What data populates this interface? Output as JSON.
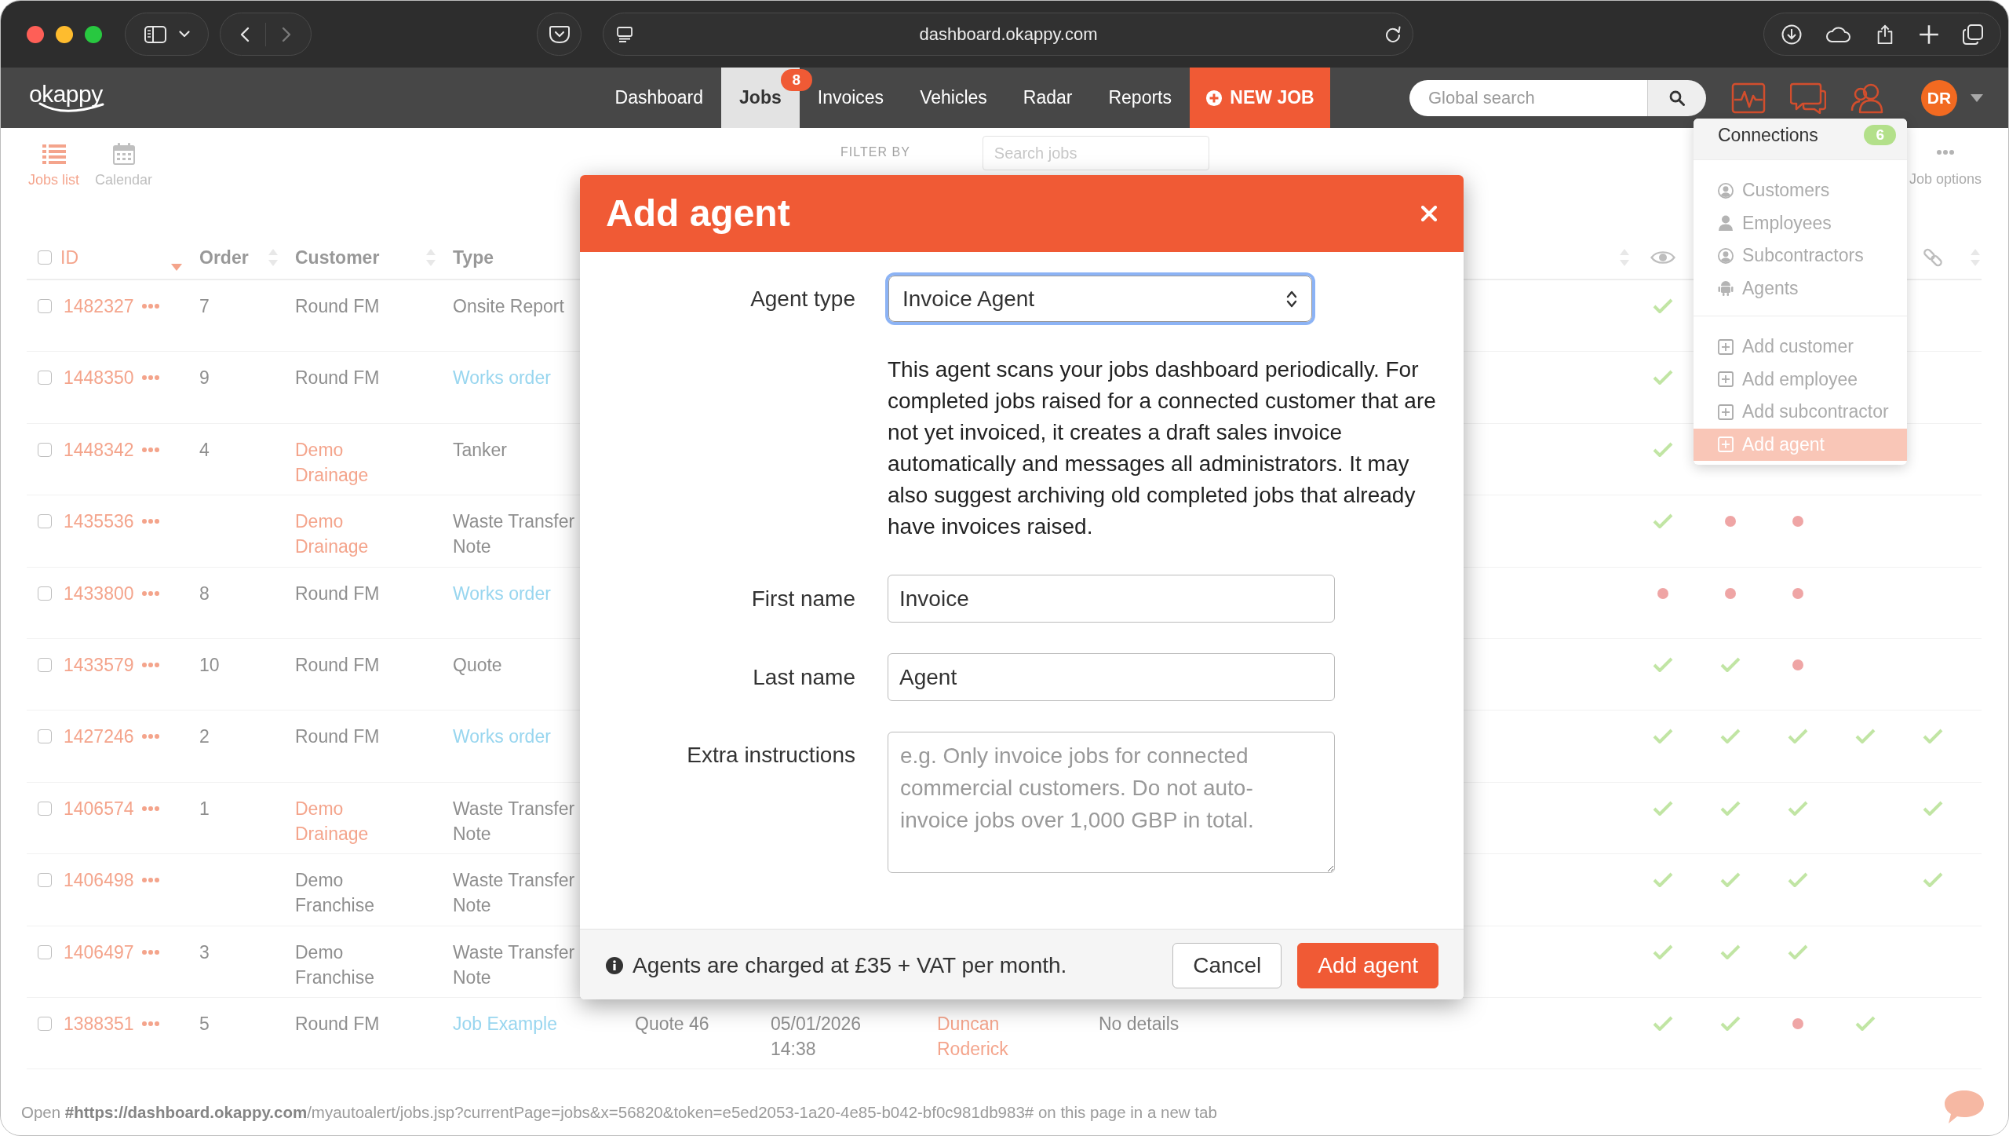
{
  "browser": {
    "url": "dashboard.okappy.com",
    "status_text": "Open **#https://dashboard.okappy.com**/myautoalert/jobs.jsp?currentPage=jobs&x=56820&token=e5ed2053-1a20-4e85-b042-bf0c981db983# on this page in a new tab"
  },
  "navbar": {
    "logo": "okappy",
    "items": [
      {
        "label": "Dashboard",
        "selected": false
      },
      {
        "label": "Jobs",
        "selected": true,
        "badge": "8"
      },
      {
        "label": "Invoices",
        "selected": false
      },
      {
        "label": "Vehicles",
        "selected": false
      },
      {
        "label": "Radar",
        "selected": false
      },
      {
        "label": "Reports",
        "selected": false
      }
    ],
    "new_job": "NEW JOB",
    "search": {
      "placeholder": "Global search"
    },
    "avatar": "DR"
  },
  "toolbar": {
    "views": [
      {
        "label": "Jobs list",
        "selected": true
      },
      {
        "label": "Calendar",
        "selected": false
      }
    ],
    "filter_label": "FILTER BY",
    "search": {
      "placeholder": "Search jobs"
    },
    "job_options": "Job options"
  },
  "table": {
    "select_all": {
      "checked": false
    },
    "columns": [
      {
        "label": "ID",
        "sorted": true
      },
      {
        "label": "Order",
        "sorted": false
      },
      {
        "label": "Customer",
        "sorted": false
      },
      {
        "label": "Type",
        "sorted": false
      }
    ],
    "rows": [
      {
        "checked": false,
        "id": "1482327",
        "order": "7",
        "customer": "Round FM",
        "customer_link": false,
        "type": "Onsite Report",
        "type_link": false,
        "marks": [
          {
            "kind": "check"
          },
          {
            "kind": "empty"
          },
          {
            "kind": "empty"
          },
          {
            "kind": "empty"
          },
          {
            "kind": "empty"
          }
        ]
      },
      {
        "checked": false,
        "id": "1448350",
        "order": "9",
        "customer": "Round FM",
        "customer_link": false,
        "type": "Works order",
        "type_link": true,
        "marks": [
          {
            "kind": "check"
          },
          {
            "kind": "empty"
          },
          {
            "kind": "empty"
          },
          {
            "kind": "empty"
          },
          {
            "kind": "empty"
          }
        ]
      },
      {
        "checked": false,
        "id": "1448342",
        "order": "4",
        "customer": "Demo Drainage",
        "customer_link": true,
        "type": "Tanker",
        "type_link": false,
        "marks": [
          {
            "kind": "check"
          },
          {
            "kind": "empty"
          },
          {
            "kind": "empty"
          },
          {
            "kind": "empty"
          },
          {
            "kind": "empty"
          }
        ]
      },
      {
        "checked": false,
        "id": "1435536",
        "customer": "Demo Drainage",
        "customer_link": true,
        "type": "Waste Transfer Note",
        "type_link": false,
        "marks": [
          {
            "kind": "check"
          },
          {
            "kind": "dot"
          },
          {
            "kind": "dot"
          },
          {
            "kind": "empty"
          },
          {
            "kind": "empty"
          }
        ]
      },
      {
        "checked": false,
        "id": "1433800",
        "order": "8",
        "customer": "Round FM",
        "customer_link": false,
        "type": "Works order",
        "type_link": true,
        "marks": [
          {
            "kind": "dot"
          },
          {
            "kind": "dot"
          },
          {
            "kind": "dot"
          },
          {
            "kind": "empty"
          },
          {
            "kind": "empty"
          }
        ]
      },
      {
        "checked": false,
        "id": "1433579",
        "order": "10",
        "customer": "Round FM",
        "customer_link": false,
        "type": "Quote",
        "type_link": false,
        "marks": [
          {
            "kind": "check"
          },
          {
            "kind": "check"
          },
          {
            "kind": "dot"
          },
          {
            "kind": "empty"
          },
          {
            "kind": "empty"
          }
        ]
      },
      {
        "checked": false,
        "id": "1427246",
        "order": "2",
        "customer": "Round FM",
        "customer_link": false,
        "type": "Works order",
        "type_link": true,
        "marks": [
          {
            "kind": "check"
          },
          {
            "kind": "check"
          },
          {
            "kind": "check"
          },
          {
            "kind": "check"
          },
          {
            "kind": "check"
          }
        ]
      },
      {
        "checked": false,
        "id": "1406574",
        "order": "1",
        "customer": "Demo Drainage",
        "customer_link": true,
        "type": "Waste Transfer Note",
        "type_link": false,
        "marks": [
          {
            "kind": "check"
          },
          {
            "kind": "check"
          },
          {
            "kind": "check"
          },
          {
            "kind": "empty"
          },
          {
            "kind": "check"
          }
        ]
      },
      {
        "checked": false,
        "id": "1406498",
        "customer": "Demo Franchise",
        "customer_link": false,
        "type": "Waste Transfer Note",
        "type_link": false,
        "marks": [
          {
            "kind": "check"
          },
          {
            "kind": "check"
          },
          {
            "kind": "check"
          },
          {
            "kind": "empty"
          },
          {
            "kind": "check"
          }
        ]
      },
      {
        "checked": false,
        "id": "1406497",
        "order": "3",
        "customer": "Demo Franchise",
        "customer_link": false,
        "type": "Waste Transfer Note",
        "type_link": false,
        "marks": [
          {
            "kind": "check"
          },
          {
            "kind": "check"
          },
          {
            "kind": "check"
          },
          {
            "kind": "empty"
          },
          {
            "kind": "empty"
          }
        ]
      },
      {
        "checked": false,
        "id": "1388351",
        "order": "5",
        "customer": "Round FM",
        "customer_link": false,
        "type": "Job Example",
        "type_link": true,
        "column_5": "Quote 46",
        "column_6": "05/01/2026 14:38",
        "column_7": "Duncan Roderick",
        "column_7_link": true,
        "column_8": "No details",
        "marks": [
          {
            "kind": "check"
          },
          {
            "kind": "check"
          },
          {
            "kind": "dot"
          },
          {
            "kind": "check"
          },
          {
            "kind": "empty"
          }
        ]
      }
    ]
  },
  "connections_menu": {
    "title": "Connections",
    "count": "6",
    "views": [
      {
        "label": "Customers"
      },
      {
        "label": "Employees"
      },
      {
        "label": "Subcontractors"
      },
      {
        "label": "Agents"
      }
    ],
    "actions": [
      {
        "label": "Add customer",
        "selected": false
      },
      {
        "label": "Add employee",
        "selected": false
      },
      {
        "label": "Add subcontractor",
        "selected": false
      },
      {
        "label": "Add agent",
        "selected": true
      }
    ]
  },
  "modal": {
    "title": "Add agent",
    "agent_type": {
      "label": "Agent type",
      "value": "Invoice Agent",
      "focused": true
    },
    "description": "This agent scans your jobs dashboard periodically. For completed jobs raised for a connected customer that are not yet invoiced, it creates a draft sales invoice automatically and messages all administrators. It may also suggest archiving old completed jobs that already have invoices raised.",
    "first_name": {
      "label": "First name",
      "value": "Invoice"
    },
    "last_name": {
      "label": "Last name",
      "value": "Agent"
    },
    "extra_instructions": {
      "label": "Extra instructions",
      "placeholder": "e.g. Only invoice jobs for connected commercial customers. Do not auto-invoice jobs over 1,000 GBP in total."
    },
    "footer_note": "Agents are charged at £35 + VAT per month.",
    "buttons": [
      {
        "label": "Cancel",
        "kind": "secondary"
      },
      {
        "label": "Add agent",
        "kind": "primary"
      }
    ]
  }
}
